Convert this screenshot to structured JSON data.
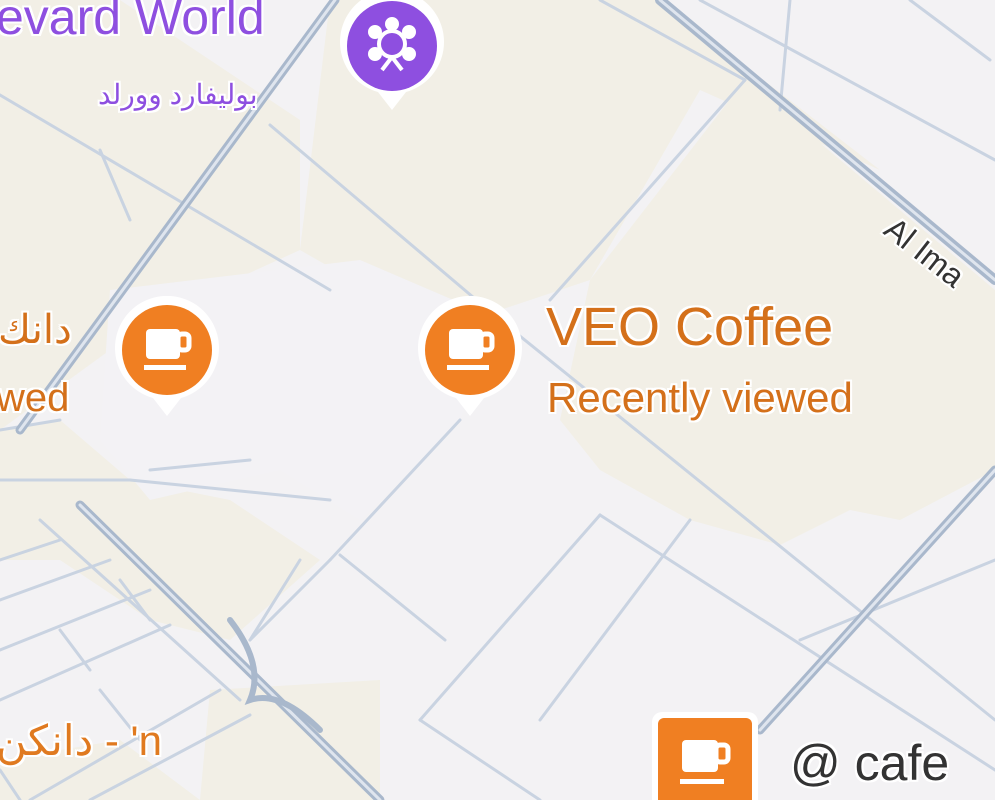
{
  "places": {
    "boulevard_world": {
      "name_en": "evard World",
      "name_ar": "بوليفارد وورلد",
      "icon": "attraction-icon",
      "color": "#8e4fe0"
    },
    "veo_coffee": {
      "name": "VEO Coffee",
      "status": "Recently viewed",
      "icon": "coffee-cup-icon",
      "color": "#f07f22"
    },
    "dunkin_left": {
      "name_ar": "دانك",
      "status": "wed",
      "icon": "coffee-cup-icon",
      "color": "#f07f22"
    },
    "dunkin_bottom": {
      "name": "دانكن - 'n",
      "color": "#e07a20"
    },
    "cafe_bottom": {
      "name": "@ cafe",
      "icon": "coffee-cup-icon",
      "color": "#f07f22"
    }
  },
  "streets": {
    "al_imam": "Al Ima"
  },
  "colors": {
    "land": "#f3f2f4",
    "beige": "#f2efe6",
    "road": "#c9d3e1",
    "road_major": "#9fb0c7",
    "poi_text_orange": "#d4701a",
    "poi_text_purple": "#8e4fe0"
  }
}
